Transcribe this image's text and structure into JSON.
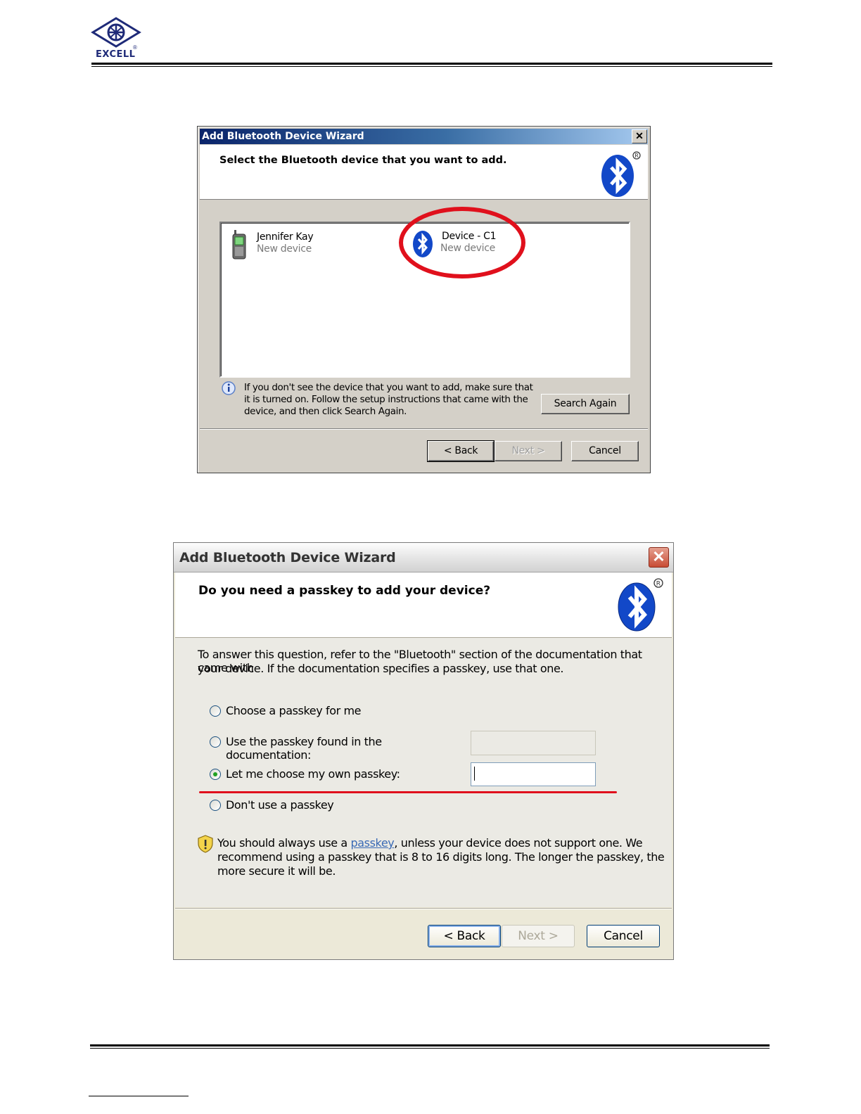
{
  "header": {
    "logo_text": "EXCELL",
    "logo_reg": "®"
  },
  "dialog1": {
    "title": "Add Bluetooth Device Wizard",
    "close": "✕",
    "heading": "Select the Bluetooth device that you want to add.",
    "devices": [
      {
        "name": "Jennifer Kay",
        "status": "New device",
        "icon": "phone-icon"
      },
      {
        "name": "Device - C1",
        "status": "New device",
        "icon": "bluetooth-icon"
      }
    ],
    "info_text": "If you don't see the device that you want to add, make sure that it is turned on. Follow the setup instructions that came with the device, and then click Search Again.",
    "search_again": "Search Again",
    "back": "< Back",
    "next": "Next >",
    "cancel": "Cancel"
  },
  "dialog2": {
    "title": "Add Bluetooth Device Wizard",
    "close": "✕",
    "heading": "Do you need a passkey to add your device?",
    "intro_line1": "To answer this question, refer to the \"Bluetooth\" section of the documentation that came with",
    "intro_line2": "your device. If the documentation specifies a passkey, use that one.",
    "options": [
      {
        "label": "Choose a passkey for me",
        "selected": false
      },
      {
        "label": "Use the passkey found in the documentation:",
        "selected": false
      },
      {
        "label": "Let me choose my own passkey:",
        "selected": true
      },
      {
        "label": "Don't use a passkey",
        "selected": false
      }
    ],
    "doc_passkey_value": "",
    "own_passkey_value": "",
    "warn_pre": "You should always use a ",
    "warn_link": "passkey",
    "warn_post": ", unless your device does not support one. We",
    "warn_line2": "recommend using a passkey that is 8 to 16 digits long. The longer the passkey, the",
    "warn_line3": "more secure it will be.",
    "back": "< Back",
    "next": "Next >",
    "cancel": "Cancel"
  },
  "colors": {
    "highlight_red": "#e0101c",
    "bluetooth_blue": "#1248c8"
  }
}
